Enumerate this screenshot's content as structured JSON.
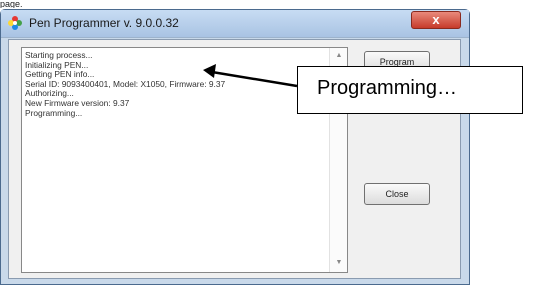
{
  "top_fragment": "page.",
  "window": {
    "title": "Pen Programmer v. 9.0.0.32",
    "close_glyph": "x",
    "app_icon": "flower-app-icon"
  },
  "log": {
    "lines": [
      "Starting process...",
      "Initializing PEN...",
      "Getting PEN info...",
      "Serial ID: 9093400401, Model: X1050, Firmware: 9.37",
      "Authorizing...",
      "New Firmware version: 9.37",
      "Programming..."
    ]
  },
  "buttons": {
    "program": "Program",
    "close": "Close"
  },
  "callout": {
    "text": "Programming…"
  },
  "colors": {
    "titlebar": "#b7cfeb",
    "close_button": "#c63b2a",
    "client_bg": "#f0f0f0"
  }
}
